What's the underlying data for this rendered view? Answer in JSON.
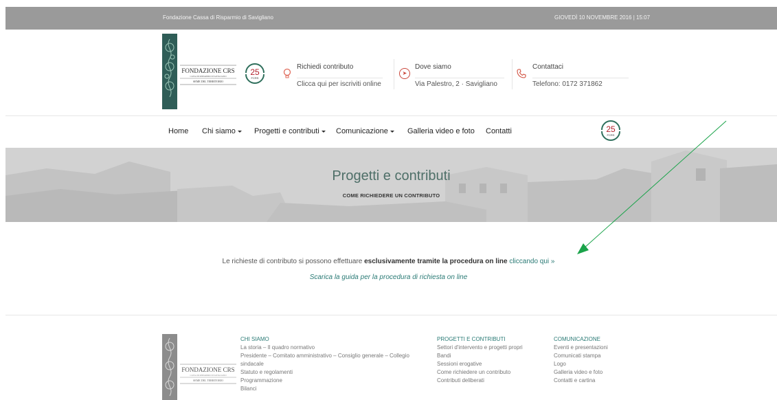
{
  "topbar": {
    "org": "Fondazione Cassa di Risparmio di Savigliano",
    "date": "GIOVEDÌ 10 NOVEMBRE 2016 | 15:07"
  },
  "logo": {
    "name": "FONDAZIONE CRS",
    "line2": "CASSA DI RISPARMIO DI SAVIGLIANO",
    "motto": "SEME DEL TERRITORIO"
  },
  "badge": {
    "number": "25",
    "text": "FCRS"
  },
  "info": [
    {
      "label": "Richiedi contributo",
      "sub": "Clicca qui per iscriviti online",
      "icon": "lightbulb-icon"
    },
    {
      "label": "Dove siamo",
      "sub": "Via Palestro, 2 · Savigliano",
      "icon": "location-arrow-icon"
    },
    {
      "label": "Contattaci",
      "sub": "Telefono: 0172 371862",
      "icon": "phone-icon"
    }
  ],
  "nav": [
    {
      "label": "Home",
      "dropdown": false
    },
    {
      "label": "Chi siamo",
      "dropdown": true
    },
    {
      "label": "Progetti e contributi",
      "dropdown": true
    },
    {
      "label": "Comunicazione",
      "dropdown": true
    },
    {
      "label": "Galleria video e foto",
      "dropdown": false
    },
    {
      "label": "Contatti",
      "dropdown": false
    }
  ],
  "hero": {
    "title": "Progetti e contributi",
    "subtitle": "COME RICHIEDERE UN CONTRIBUTO"
  },
  "content": {
    "text_before": "Le richieste di contributo si possono effettuare ",
    "bold": "esclusivamente tramite la procedura on line",
    "link": "cliccando qui »",
    "guide_link": "Scarica la guida per la procedura di richiesta on line"
  },
  "footer": {
    "chi_siamo": {
      "head": "CHI SIAMO",
      "items": [
        "La storia – Il quadro normativo",
        "Presidente – Comitato amministrativo – Consiglio generale – Collegio sindacale",
        "Statuto e regolamenti",
        "Programmazione",
        "Bilanci"
      ]
    },
    "progetti": {
      "head": "PROGETTI E CONTRIBUTI",
      "items": [
        "Settori d'intervento e progetti propri",
        "Bandi",
        "Sessioni erogative",
        "Come richiedere un contributo",
        "Contributi deliberati"
      ]
    },
    "comunicazione": {
      "head": "COMUNICAZIONE",
      "items": [
        "Eventi e presentazioni",
        "Comunicati stampa",
        "Logo",
        "Galleria video e foto",
        "Contatti e cartina"
      ]
    }
  },
  "colors": {
    "accent": "#2a7a75",
    "topbar": "#9a9a9a",
    "icon": "#e06a5a",
    "arrow": "#1aa34a"
  }
}
